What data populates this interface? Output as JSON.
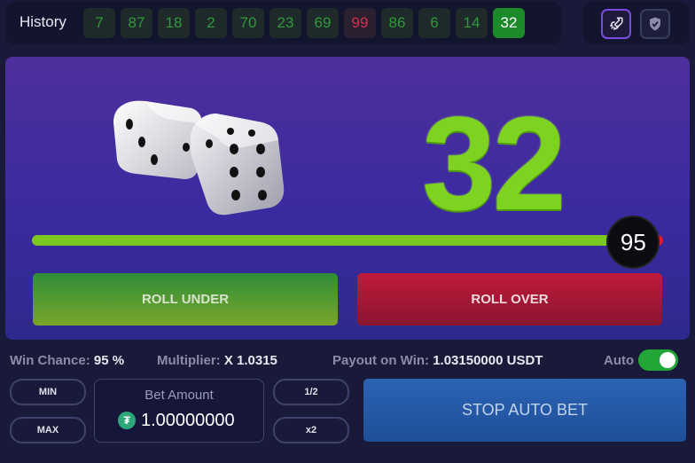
{
  "history": {
    "title": "History",
    "items": [
      {
        "value": "7",
        "state": "win"
      },
      {
        "value": "87",
        "state": "win"
      },
      {
        "value": "18",
        "state": "win"
      },
      {
        "value": "2",
        "state": "win"
      },
      {
        "value": "70",
        "state": "win"
      },
      {
        "value": "23",
        "state": "win"
      },
      {
        "value": "69",
        "state": "win"
      },
      {
        "value": "99",
        "state": "lose"
      },
      {
        "value": "86",
        "state": "win"
      },
      {
        "value": "6",
        "state": "win"
      },
      {
        "value": "14",
        "state": "win"
      },
      {
        "value": "32",
        "state": "current"
      }
    ]
  },
  "top_icons": {
    "rocket": "rocket-icon",
    "shield": "shield-check-icon"
  },
  "game": {
    "result": "32",
    "slider_value": "95",
    "slider_fraction": 0.95,
    "roll_under_label": "ROLL UNDER",
    "roll_over_label": "ROLL OVER"
  },
  "stats": {
    "win_chance_label": "Win Chance:",
    "win_chance_value": "95 %",
    "multiplier_label": "Multiplier:",
    "multiplier_value": "X 1.0315",
    "payout_label": "Payout on Win:",
    "payout_value": "1.03150000 USDT",
    "auto_label": "Auto",
    "auto_on": true
  },
  "bet": {
    "min_label": "MIN",
    "max_label": "MAX",
    "half_label": "1/2",
    "double_label": "x2",
    "amount_label": "Bet Amount",
    "amount_value": "1.00000000",
    "currency_icon": "tether-icon",
    "stop_label": "STOP AUTO BET"
  },
  "colors": {
    "win": "#2e9a3a",
    "lose": "#d2304c",
    "result": "#7ed321",
    "slider_fill": "#7dc820",
    "slider_rest": "#e01a2e",
    "stop_button": "#2b63b4"
  }
}
